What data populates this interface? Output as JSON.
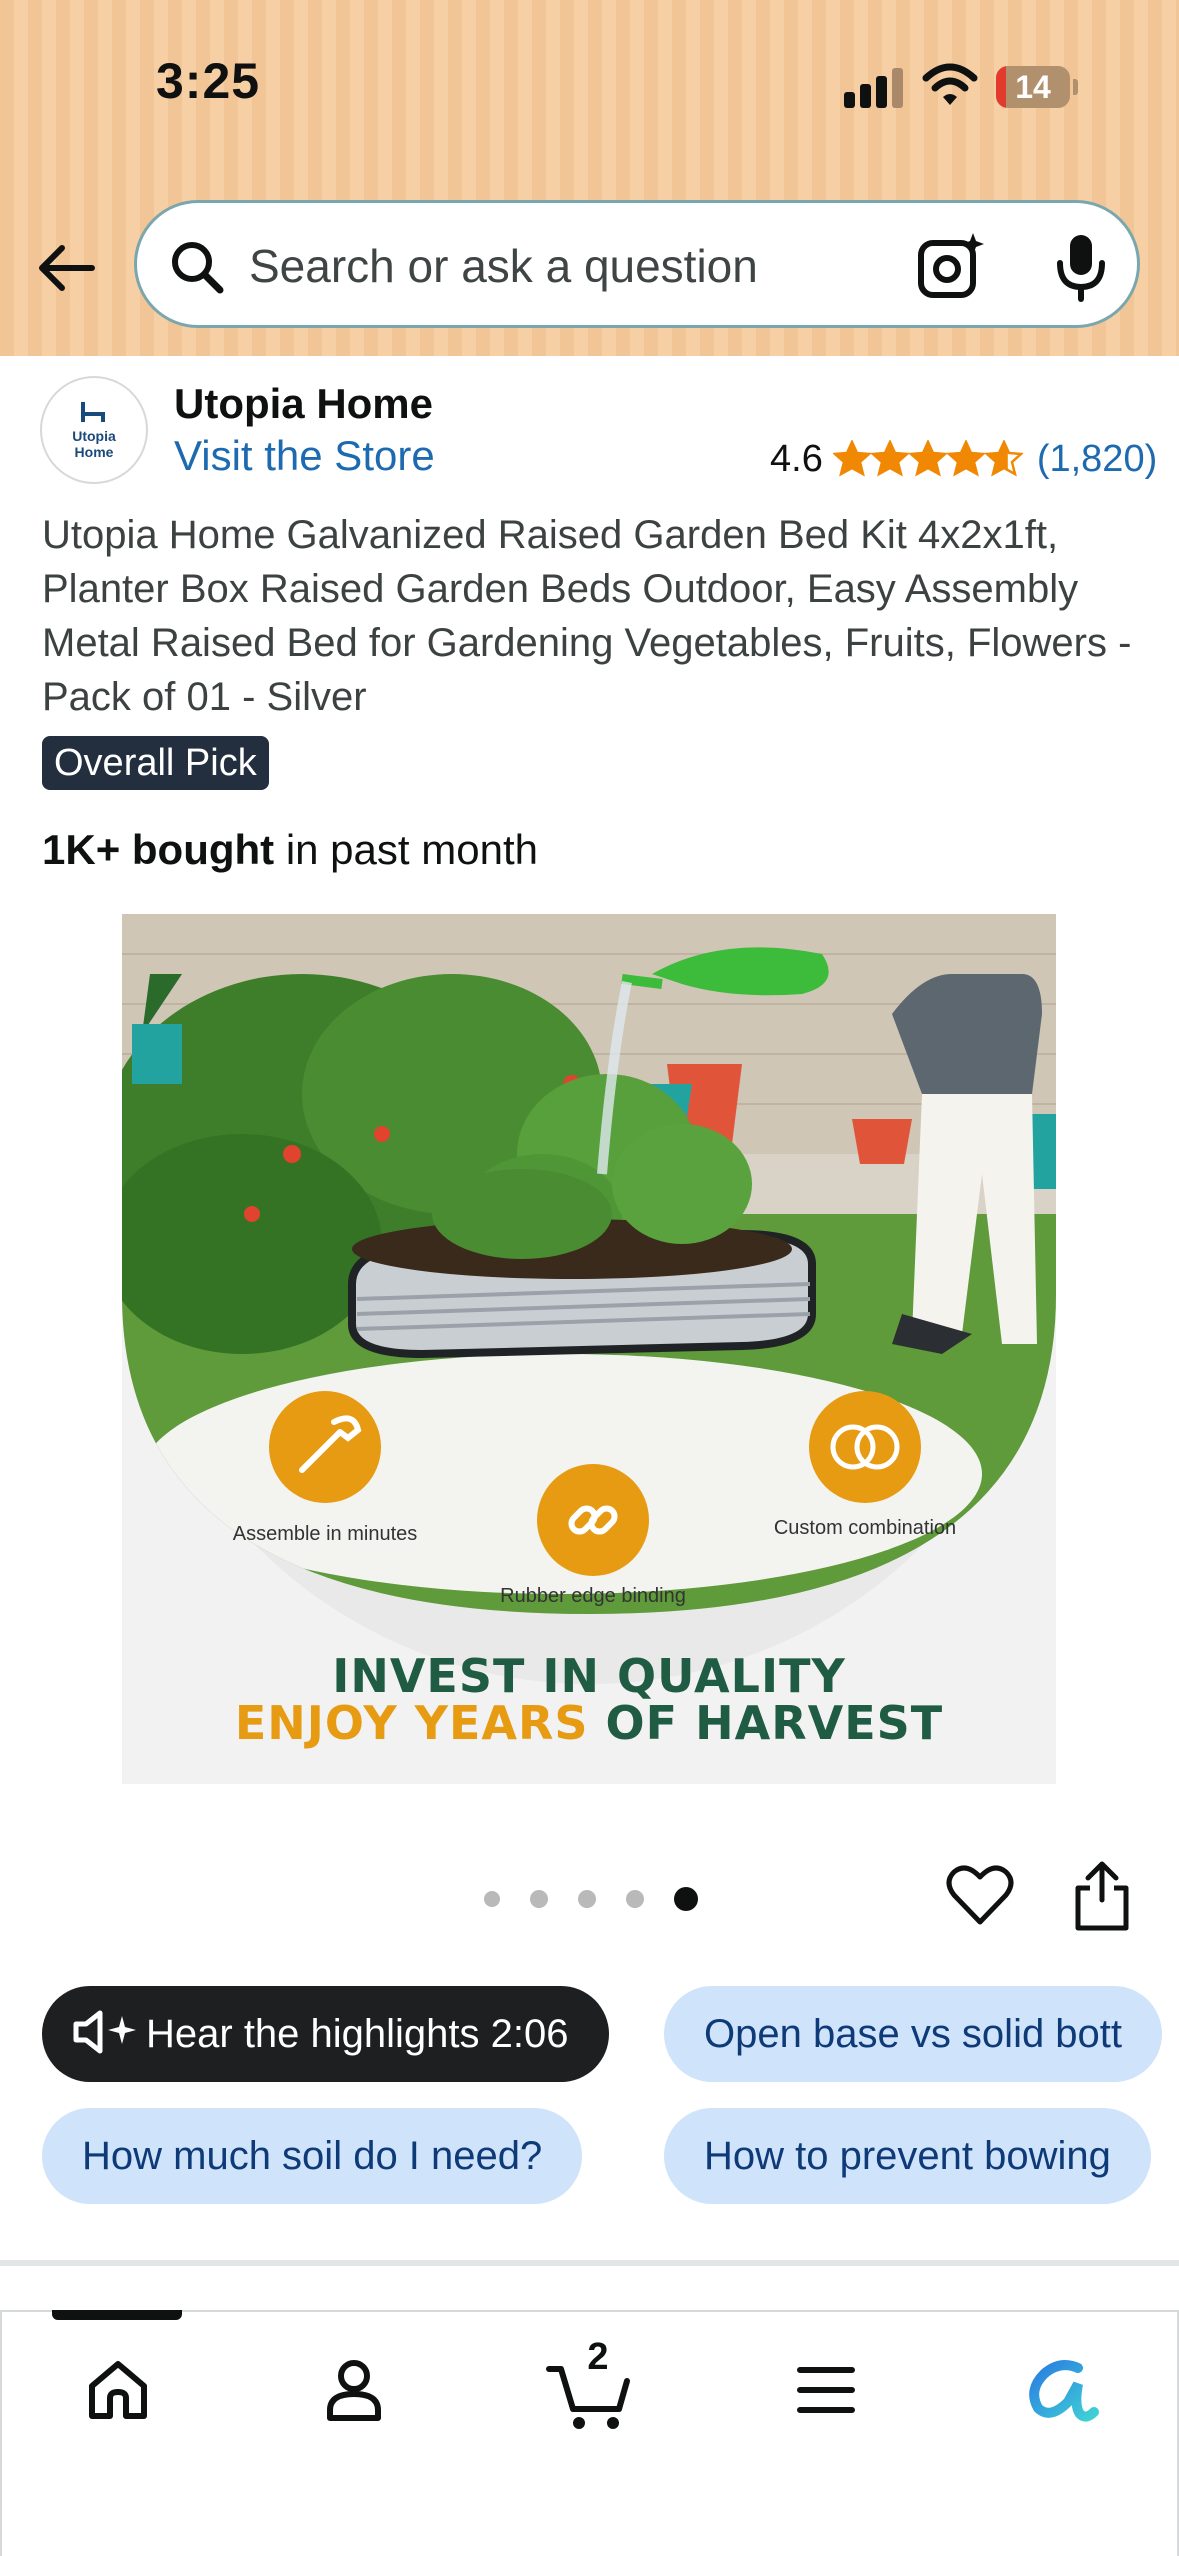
{
  "status_bar": {
    "time": "3:25",
    "battery_level": "14",
    "battery_fraction": 0.14,
    "icons": [
      "cellular-signal-icon",
      "wifi-icon",
      "battery-icon"
    ]
  },
  "search": {
    "placeholder": "Search or ask a question",
    "icons": [
      "back-arrow-icon",
      "search-icon",
      "camera-lens-icon",
      "microphone-icon"
    ]
  },
  "store": {
    "logo_text": "Utopia Home",
    "name": "Utopia Home",
    "link_label": "Visit the Store",
    "rating": "4.6",
    "rating_value": 4.6,
    "rating_count": "(1,820)"
  },
  "product": {
    "title": "Utopia Home Galvanized Raised Garden Bed Kit 4x2x1ft, Planter Box Raised Garden Beds Outdoor, Easy Assembly Metal Raised Bed for Gardening Vegetables, Fruits, Flowers - Pack of 01 - Silver",
    "badge": "Overall Pick",
    "bought_bold": "1K+ bought",
    "bought_rest": " in past month"
  },
  "image": {
    "features": [
      {
        "label": "Assemble in minutes",
        "icon": "wrench-icon"
      },
      {
        "label": "Rubber edge binding",
        "icon": "link-icon"
      },
      {
        "label": "Custom combination",
        "icon": "rings-icon"
      }
    ],
    "promo_line1": "INVEST IN QUALITY",
    "promo_line2_highlight": "ENJOY YEARS",
    "promo_line2_rest": " OF HARVEST",
    "pager": {
      "count": 5,
      "active_index": 4
    }
  },
  "chips": {
    "row1": [
      {
        "label": "Hear the highlights 2:06",
        "style": "dark",
        "icon": "speaker-sparkle-icon"
      },
      {
        "label": "Open base vs solid bott",
        "style": "light"
      }
    ],
    "row2": [
      {
        "label": "How much soil do I need?",
        "style": "light"
      },
      {
        "label": "How to prevent bowing",
        "style": "light"
      }
    ]
  },
  "bottom_nav": {
    "items": [
      "home-icon",
      "account-icon",
      "cart-icon",
      "menu-icon",
      "rufus-icon"
    ],
    "cart_count": "2"
  },
  "colors": {
    "header_bg": "#f3c89a",
    "link": "#1d6ab0",
    "star": "#f08804",
    "chip_light": "#cfe3fb",
    "chip_dark": "#1d1f21",
    "promo_green": "#1f5c43",
    "promo_orange": "#e69b12"
  }
}
